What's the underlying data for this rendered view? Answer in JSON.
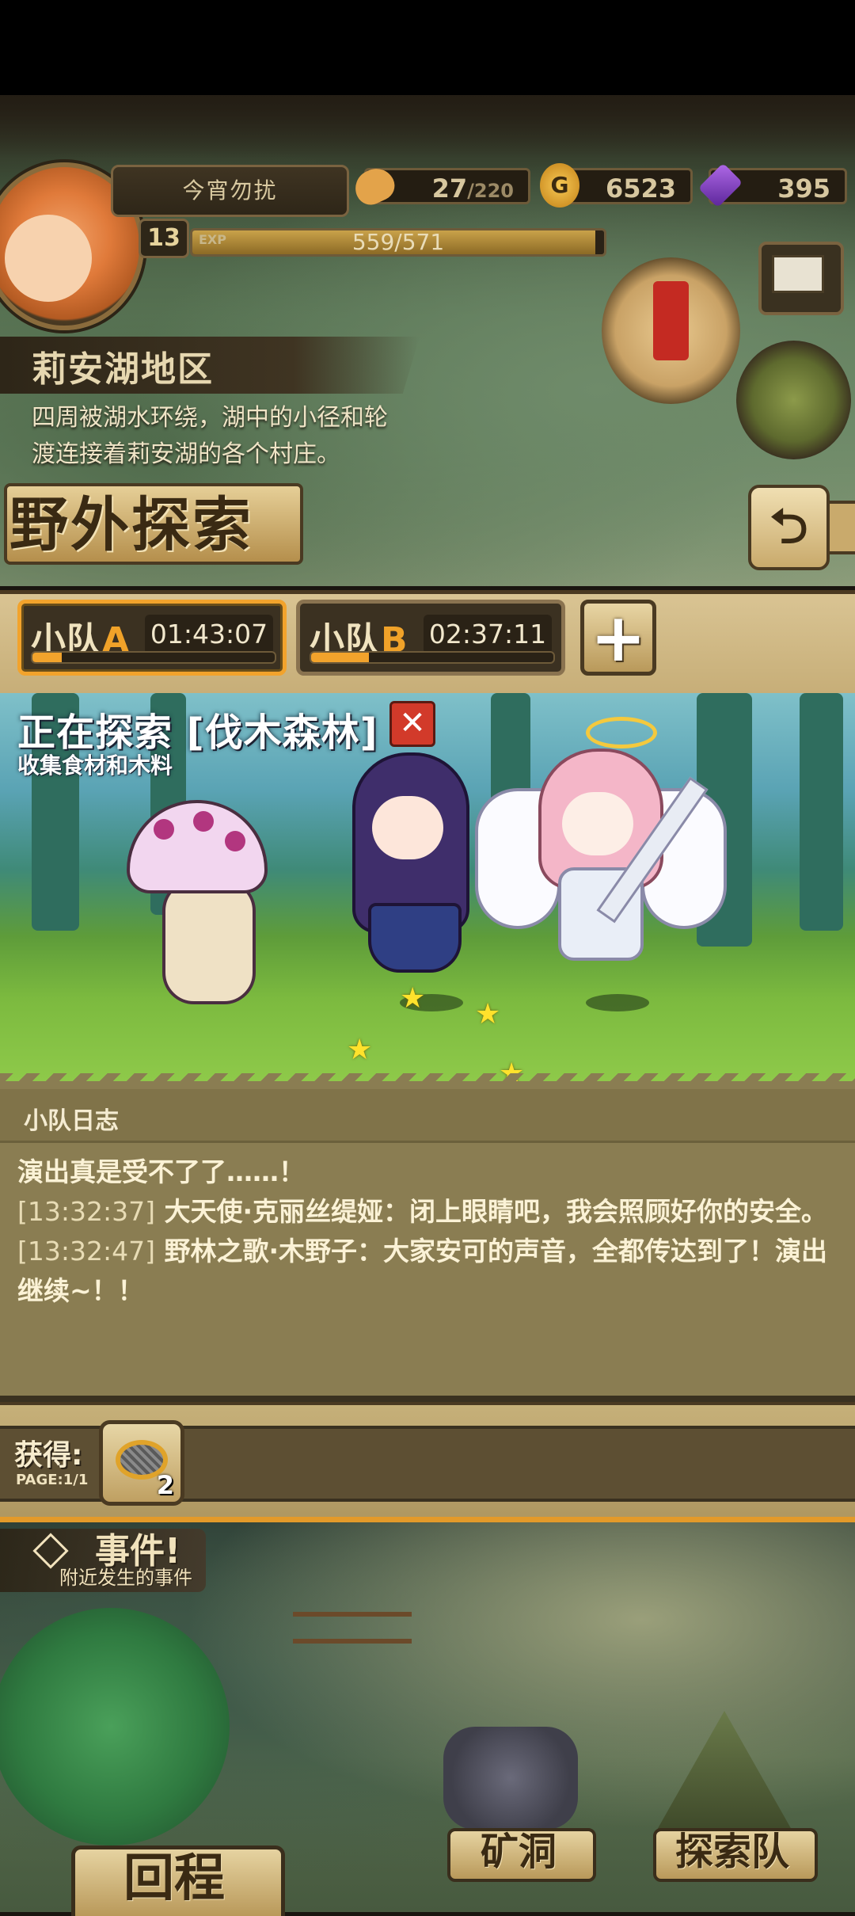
{
  "player": {
    "name": "今宵勿扰",
    "level": "13",
    "exp_label": "EXP",
    "exp_text": "559/571",
    "exp_fraction": 0.979
  },
  "resources": {
    "bread": {
      "value": "27",
      "cap": "/220",
      "icon": "bread-icon"
    },
    "gold": {
      "value": "6523",
      "icon_text": "G",
      "icon": "gold-coin-icon"
    },
    "gems": {
      "value": "395",
      "icon": "purple-gem-icon"
    }
  },
  "region": {
    "name": "莉安湖地区",
    "description_line1": "四周被湖水环绕，湖中的小径和轮",
    "description_line2": "渡连接着莉安湖的各个村庄。"
  },
  "page_title": "野外探索",
  "back_button_glyph": "⮌",
  "teams": [
    {
      "prefix": "小队",
      "letter": "A",
      "time": "01:43:07",
      "progress": 0.12,
      "active": true
    },
    {
      "prefix": "小队",
      "letter": "B",
      "time": "02:37:11",
      "progress": 0.24,
      "active": false
    }
  ],
  "add_team_glyph": "+",
  "exploring": {
    "title": "正在探索 [伐木森林]",
    "subtitle": "收集食材和木料",
    "cancel_glyph": "✕"
  },
  "log": {
    "title": "小队日志",
    "entries": [
      {
        "time": "",
        "text": "演出真是受不了了……！"
      },
      {
        "time": "[13:32:37]",
        "text": " 大天使·克丽丝缇娅：闭上眼睛吧，我会照顾好你的安全。"
      },
      {
        "time": "[13:32:47]",
        "text": " 野林之歌·木野子：大家安可的声音，全都传达到了！演出继续~！！"
      }
    ]
  },
  "obtain": {
    "label": "获得:",
    "page": "PAGE:1/1",
    "items": [
      {
        "icon": "mesh-net-icon",
        "quantity": "2"
      }
    ]
  },
  "map": {
    "event_title": "事件!",
    "event_sub": "附近发生的事件",
    "mine_label": "矿洞",
    "camp_label": "探索队",
    "return_label": "回程"
  }
}
